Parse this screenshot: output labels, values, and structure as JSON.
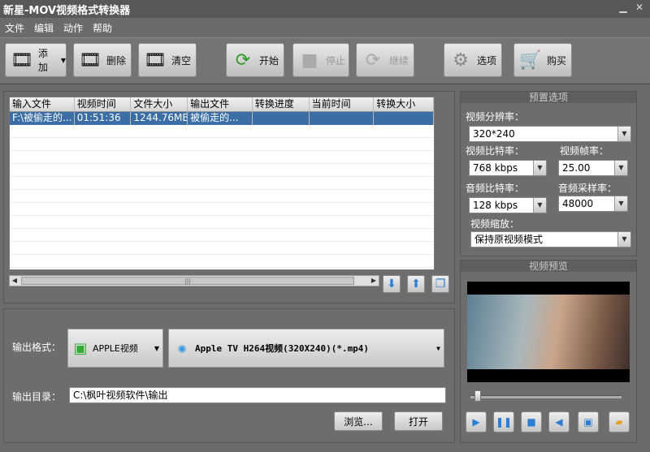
{
  "window": {
    "title": "新星-MOV视频格式转换器"
  },
  "menu": [
    "文件",
    "编辑",
    "动作",
    "帮助"
  ],
  "toolbar": {
    "add": "添加",
    "delete": "删除",
    "clear": "清空",
    "start": "开始",
    "stop": "停止",
    "continue": "继续",
    "options": "选项",
    "buy": "购买"
  },
  "table": {
    "columns": [
      "输入文件",
      "视频时间",
      "文件大小",
      "输出文件",
      "转换进度",
      "当前时间",
      "转换大小"
    ],
    "rows": [
      [
        "F:\\被偷走的...",
        "01:51:36",
        "1244.76MB",
        "被偷走的...",
        "",
        "",
        ""
      ]
    ]
  },
  "output": {
    "format_label": "输出格式：",
    "category": "APPLE视频",
    "format": "Apple TV H264视频(320X240)(*.mp4)",
    "dir_label": "输出目录：",
    "dir_value": "C:\\枫叶视频软件\\输出",
    "browse": "浏览...",
    "open": "打开"
  },
  "preset": {
    "title": "预置选项",
    "resolution_label": "视频分辨率：",
    "resolution": "320*240",
    "vbitrate_label": "视频比特率：",
    "vbitrate": "768 kbps",
    "fps_label": "视频帧率：",
    "fps": "25.00",
    "abitrate_label": "音频比特率：",
    "abitrate": "128 kbps",
    "samplerate_label": "音频采样率：",
    "samplerate": "48000",
    "scale_label": "视频缩放：",
    "scale": "保持原视频模式"
  },
  "preview": {
    "title": "视频预览",
    "position": 0.05
  },
  "colors": {
    "accent": "#2a7fd4",
    "selection": "#3a6ea5"
  }
}
